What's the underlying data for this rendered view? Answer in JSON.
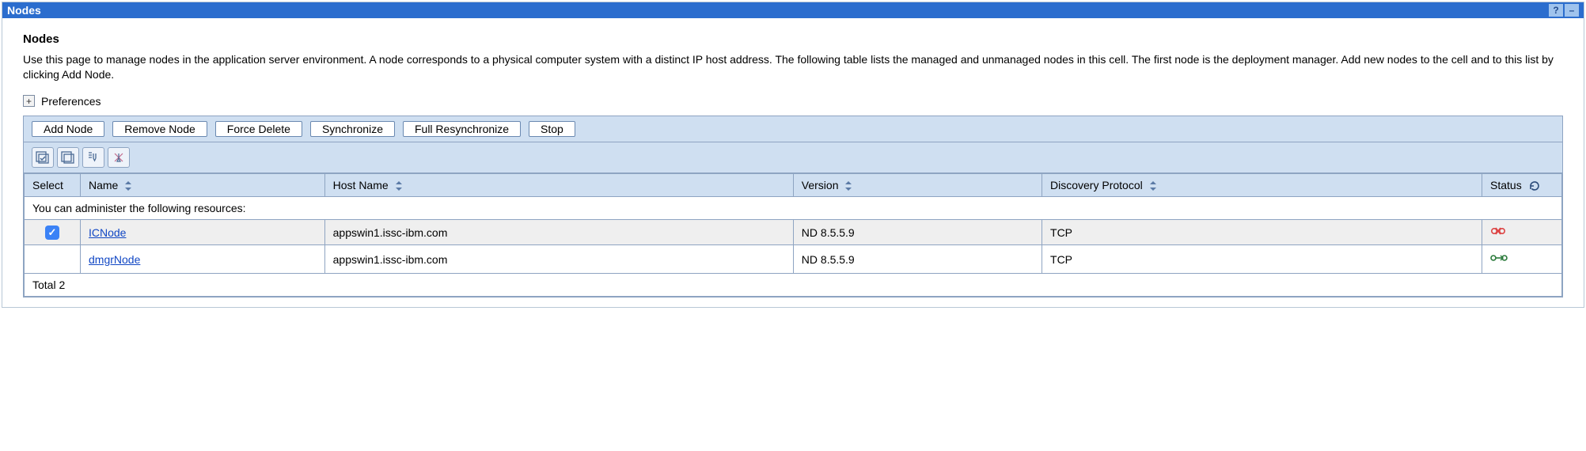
{
  "portlet": {
    "title": "Nodes"
  },
  "page": {
    "title": "Nodes",
    "description": "Use this page to manage nodes in the application server environment. A node corresponds to a physical computer system with a distinct IP host address. The following table lists the managed and unmanaged nodes in this cell. The first node is the deployment manager. Add new nodes to the cell and to this list by clicking Add Node.",
    "preferences_label": "Preferences"
  },
  "actions": {
    "add_node": "Add Node",
    "remove_node": "Remove Node",
    "force_delete": "Force Delete",
    "synchronize": "Synchronize",
    "full_resynchronize": "Full Resynchronize",
    "stop": "Stop"
  },
  "columns": {
    "select": "Select",
    "name": "Name",
    "host_name": "Host Name",
    "version": "Version",
    "discovery_protocol": "Discovery Protocol",
    "status": "Status"
  },
  "section_label": "You can administer the following resources:",
  "rows": [
    {
      "selected": true,
      "name": "ICNode",
      "host_name": "appswin1.issc-ibm.com",
      "version": "ND 8.5.5.9",
      "discovery_protocol": "TCP",
      "status": "unsynchronized"
    },
    {
      "selected": false,
      "name": "dmgrNode",
      "host_name": "appswin1.issc-ibm.com",
      "version": "ND 8.5.5.9",
      "discovery_protocol": "TCP",
      "status": "synchronized"
    }
  ],
  "footer": "Total 2"
}
